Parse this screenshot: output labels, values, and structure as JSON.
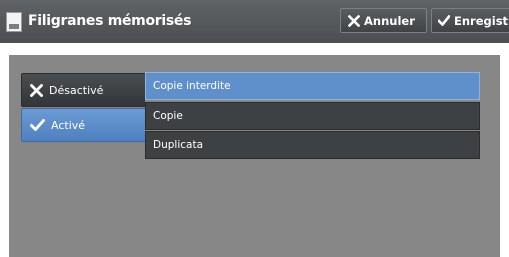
{
  "header": {
    "title": "Filigranes mémorisés",
    "icon": "watermark-document-icon",
    "cancel_label": "Annuler",
    "save_label": "Enregistrer"
  },
  "options": {
    "off_label": "Désactivé",
    "on_label": "Activé",
    "selected": "Activé"
  },
  "list": {
    "items": [
      "Copie interdite",
      "Copie",
      "Duplicata"
    ],
    "selected_index": 0
  },
  "colors": {
    "header_bg": "#53575a",
    "panel_bg": "#878787",
    "accent_blue": "#5f90cc",
    "dark_button": "#3e4143"
  }
}
